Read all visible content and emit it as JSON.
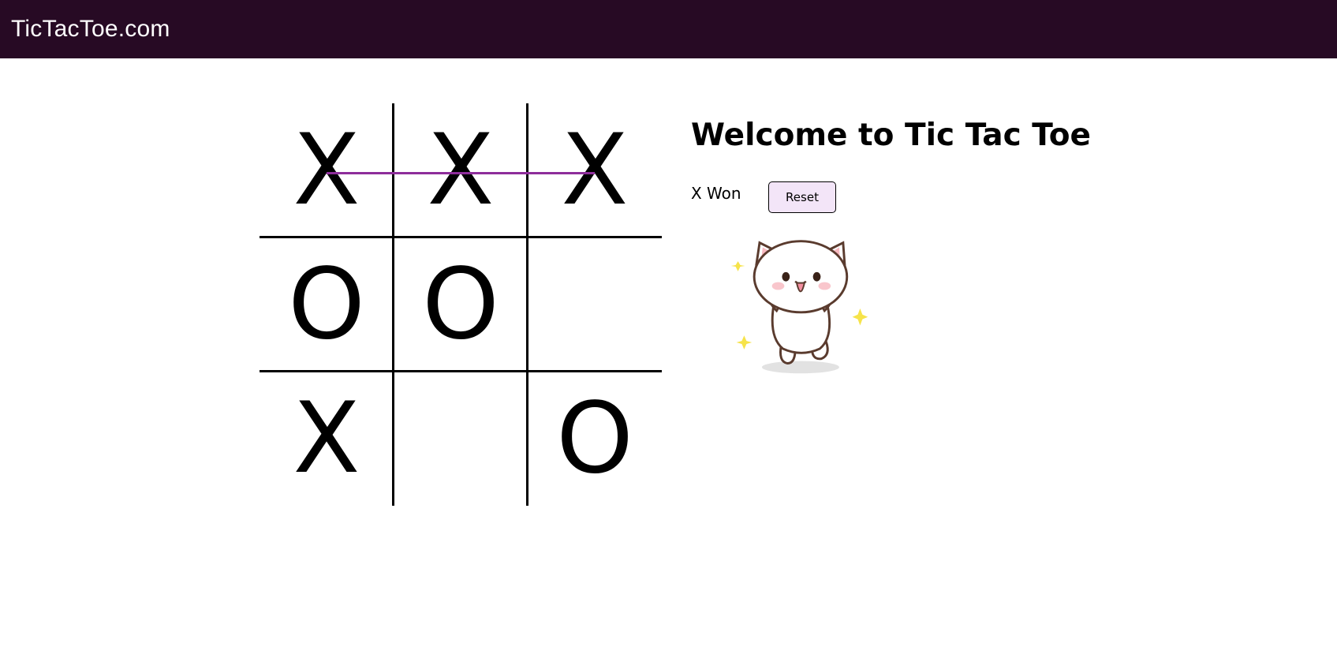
{
  "header": {
    "brand": "TicTacToe.com",
    "background": "#270a24"
  },
  "board": {
    "cells": [
      "X",
      "X",
      "X",
      "O",
      "O",
      "",
      "X",
      "",
      "O"
    ],
    "winning_line": {
      "cells": [
        0,
        1,
        2
      ],
      "color": "#8e2d9b"
    }
  },
  "side": {
    "title": "Welcome to Tic Tac Toe",
    "status": "X Won",
    "reset_label": "Reset",
    "reset_background": "#f3e5f8"
  },
  "mascot": {
    "icon": "celebrating-cat-icon"
  }
}
